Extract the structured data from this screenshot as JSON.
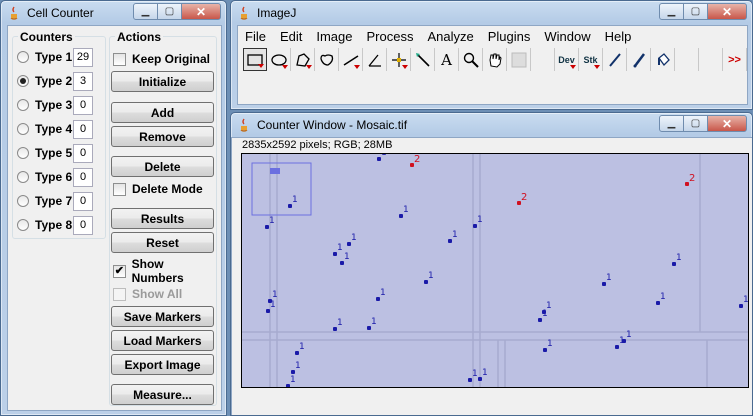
{
  "cell_counter": {
    "title": "Cell Counter",
    "counters_title": "Counters",
    "actions_title": "Actions",
    "types": [
      {
        "label": "Type 1",
        "count": "29",
        "selected": false
      },
      {
        "label": "Type 2",
        "count": "3",
        "selected": true
      },
      {
        "label": "Type 3",
        "count": "0",
        "selected": false
      },
      {
        "label": "Type 4",
        "count": "0",
        "selected": false
      },
      {
        "label": "Type 5",
        "count": "0",
        "selected": false
      },
      {
        "label": "Type 6",
        "count": "0",
        "selected": false
      },
      {
        "label": "Type 7",
        "count": "0",
        "selected": false
      },
      {
        "label": "Type 8",
        "count": "0",
        "selected": false
      }
    ],
    "keep_original": "Keep Original",
    "initialize": "Initialize",
    "add": "Add",
    "remove": "Remove",
    "delete": "Delete",
    "delete_mode": "Delete Mode",
    "results": "Results",
    "reset": "Reset",
    "show_numbers": "Show Numbers",
    "show_numbers_checked": "✔",
    "show_all": "Show All",
    "save_markers": "Save Markers",
    "load_markers": "Load Markers",
    "export_image": "Export Image",
    "measure": "Measure..."
  },
  "imagej": {
    "title": "ImageJ",
    "menus": [
      "File",
      "Edit",
      "Image",
      "Process",
      "Analyze",
      "Plugins",
      "Window",
      "Help"
    ],
    "tools": [
      "rectangle-tool-icon",
      "oval-tool-icon",
      "polygon-tool-icon",
      "freehand-tool-icon",
      "line-tool-icon",
      "angle-tool-icon",
      "point-tool-icon",
      "wand-tool-icon",
      "text-tool-icon",
      "magnifier-tool-icon",
      "hand-tool-icon",
      "color-picker-icon",
      "blank",
      "dev-tool",
      "stk-tool",
      "pencil-tool-icon",
      "brush-tool-icon",
      "flood-fill-tool-icon",
      "blank",
      "blank",
      "more-tools-icon"
    ],
    "dev_label": "Dev",
    "stk_label": "Stk",
    "more_label": ">>",
    "text_tool_glyph": "A"
  },
  "counter_window": {
    "title": "Counter Window - Mosaic.tif",
    "info": "2835x2592 pixels; RGB; 28MB",
    "markers": [
      {
        "label": "1",
        "type": 1
      },
      {
        "label": "2",
        "type": 2
      },
      {
        "label": "2",
        "type": 2
      },
      {
        "label": "2",
        "type": 2
      },
      {
        "label": "1",
        "type": 1
      },
      {
        "label": "1",
        "type": 1
      },
      {
        "label": "1",
        "type": 1
      },
      {
        "label": "1",
        "type": 1
      },
      {
        "label": "1",
        "type": 1
      },
      {
        "label": "1",
        "type": 1
      },
      {
        "label": "1",
        "type": 1
      },
      {
        "label": "1",
        "type": 1
      },
      {
        "label": "1",
        "type": 1
      },
      {
        "label": "1",
        "type": 1
      },
      {
        "label": "1",
        "type": 1
      },
      {
        "label": "1",
        "type": 1
      },
      {
        "label": "1",
        "type": 1
      },
      {
        "label": "1",
        "type": 1
      },
      {
        "label": "1",
        "type": 1
      },
      {
        "label": "1",
        "type": 1
      },
      {
        "label": "1",
        "type": 1
      },
      {
        "label": "1",
        "type": 1
      },
      {
        "label": "1",
        "type": 1
      },
      {
        "label": "1",
        "type": 1
      },
      {
        "label": "1",
        "type": 1
      },
      {
        "label": "1",
        "type": 1
      },
      {
        "label": "1",
        "type": 1
      },
      {
        "label": "1",
        "type": 1
      },
      {
        "label": "1",
        "type": 1
      },
      {
        "label": "1",
        "type": 1
      },
      {
        "label": "1",
        "type": 1
      },
      {
        "label": "1",
        "type": 1
      }
    ]
  },
  "window_buttons": {
    "minimize": "▁",
    "maximize": "▢",
    "close": "✕"
  }
}
